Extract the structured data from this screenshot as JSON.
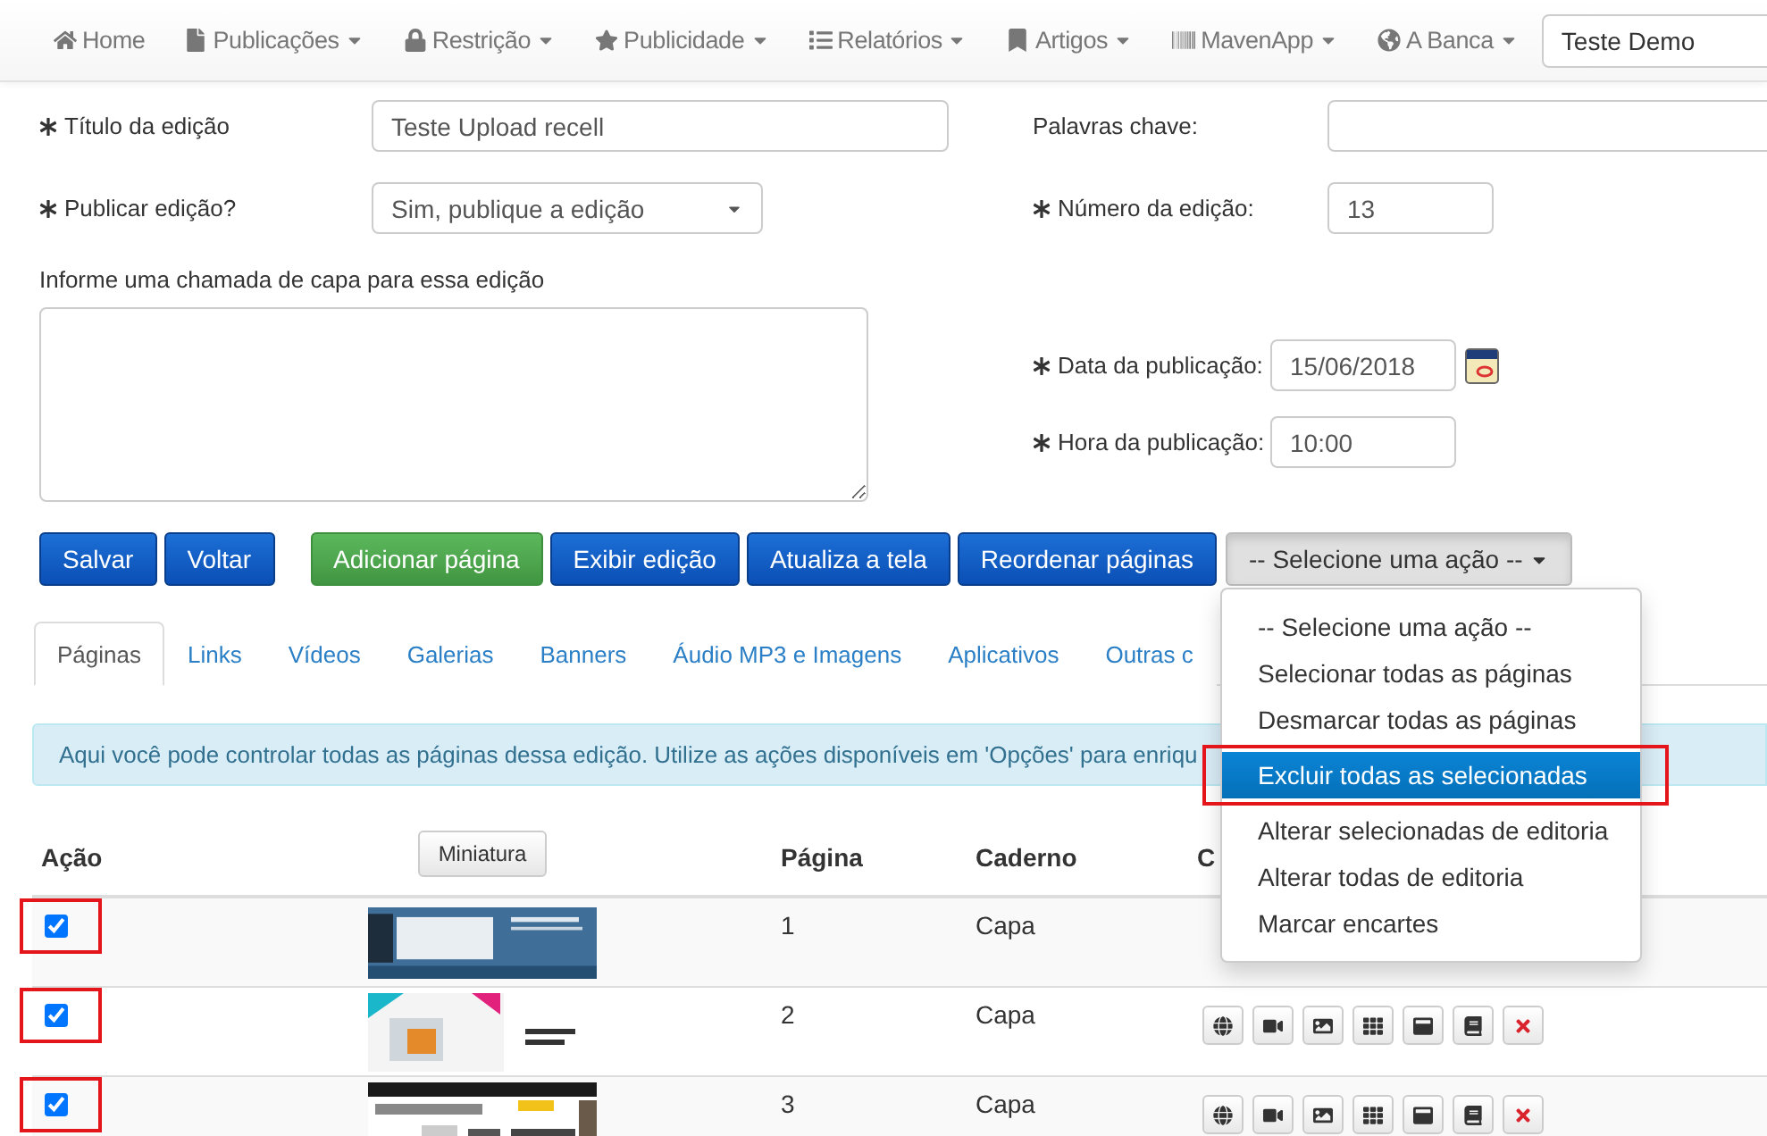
{
  "navbar": {
    "items": [
      {
        "label": "Home",
        "dropdown": false
      },
      {
        "label": "Publicações",
        "dropdown": true
      },
      {
        "label": "Restrição",
        "dropdown": true
      },
      {
        "label": "Publicidade",
        "dropdown": true
      },
      {
        "label": "Relatórios",
        "dropdown": true
      },
      {
        "label": "Artigos",
        "dropdown": true
      },
      {
        "label": "MavenApp",
        "dropdown": true
      },
      {
        "label": "A Banca",
        "dropdown": true
      }
    ],
    "user_field": {
      "value": "Teste Demo"
    }
  },
  "form": {
    "title": {
      "label": "Título da edição",
      "required": true,
      "value": "Teste Upload recell"
    },
    "publish": {
      "label": "Publicar edição?",
      "required": true,
      "value": "Sim, publique a edição"
    },
    "cover_call": {
      "label": "Informe uma chamada de capa para essa edição"
    },
    "keywords": {
      "label": "Palavras chave:",
      "required": false
    },
    "number": {
      "label": "Número da edição:",
      "required": true,
      "value": "13"
    },
    "date": {
      "label": "Data da publicação:",
      "required": true,
      "value": "15/06/2018"
    },
    "time": {
      "label": "Hora da publicação:",
      "required": true,
      "value": "10:00"
    }
  },
  "buttons": [
    {
      "label": "Salvar",
      "kind": "primary"
    },
    {
      "label": "Voltar",
      "kind": "primary"
    },
    {
      "label": "Adicionar página",
      "kind": "success"
    },
    {
      "label": "Exibir edição",
      "kind": "primary"
    },
    {
      "label": "Atualiza a tela",
      "kind": "primary"
    },
    {
      "label": "Reordenar páginas",
      "kind": "primary"
    }
  ],
  "action_select": {
    "label": "-- Selecione uma ação --",
    "expanded": true,
    "options": [
      {
        "label": "-- Selecione uma ação --",
        "selected": false
      },
      {
        "label": "Selecionar todas as páginas",
        "selected": false
      },
      {
        "label": "Desmarcar todas as páginas",
        "selected": false
      },
      {
        "label": "Excluir todas as selecionadas",
        "selected": true
      },
      {
        "label": "Alterar selecionadas de editoria",
        "selected": false
      },
      {
        "label": "Alterar todas de editoria",
        "selected": false
      },
      {
        "label": "Marcar encartes",
        "selected": false
      }
    ]
  },
  "tabs": [
    {
      "label": "Páginas",
      "selected": true
    },
    {
      "label": "Links",
      "selected": false
    },
    {
      "label": "Vídeos",
      "selected": false
    },
    {
      "label": "Galerias",
      "selected": false
    },
    {
      "label": "Banners",
      "selected": false
    },
    {
      "label": "Áudio MP3 e Imagens",
      "selected": false
    },
    {
      "label": "Aplicativos",
      "selected": false
    },
    {
      "label": "Outras c",
      "selected": false
    }
  ],
  "alert": "Aqui você pode controlar todas as páginas dessa edição. Utilize as ações disponíveis em 'Opções' para enriqu",
  "table": {
    "columns": {
      "action": "Ação",
      "thumbnail": "Miniatura",
      "page": "Página",
      "section": "Caderno",
      "column_5": "C"
    },
    "rows": [
      {
        "checked": true,
        "page": "1",
        "section": "Capa",
        "actions_visible": false
      },
      {
        "checked": true,
        "page": "2",
        "section": "Capa",
        "actions_visible": true
      },
      {
        "checked": true,
        "page": "3",
        "section": "Capa",
        "actions_visible": true
      }
    ]
  }
}
